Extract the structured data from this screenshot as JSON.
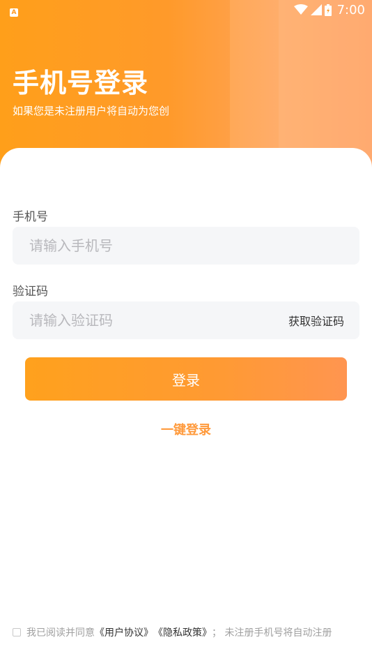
{
  "status_bar": {
    "left_icon_letter": "A",
    "time": "7:00"
  },
  "header": {
    "title": "手机号登录",
    "subtitle": "如果您是未注册用户将自动为您创"
  },
  "form": {
    "phone": {
      "label": "手机号",
      "placeholder": "请输入手机号",
      "value": ""
    },
    "code": {
      "label": "验证码",
      "placeholder": "请输入验证码",
      "value": "",
      "get_code_label": "获取验证码"
    },
    "login_label": "登录",
    "one_key_label": "一键登录"
  },
  "agreement": {
    "prefix": "我已阅读并同意",
    "user_agreement": "《用户协议》",
    "privacy_policy": "《隐私政策》",
    "suffix": "； 未注册手机号将自动注册"
  },
  "colors": {
    "accent": "#ff9a22",
    "link_orange": "#ff9a3c",
    "input_bg": "#f5f6f8"
  }
}
